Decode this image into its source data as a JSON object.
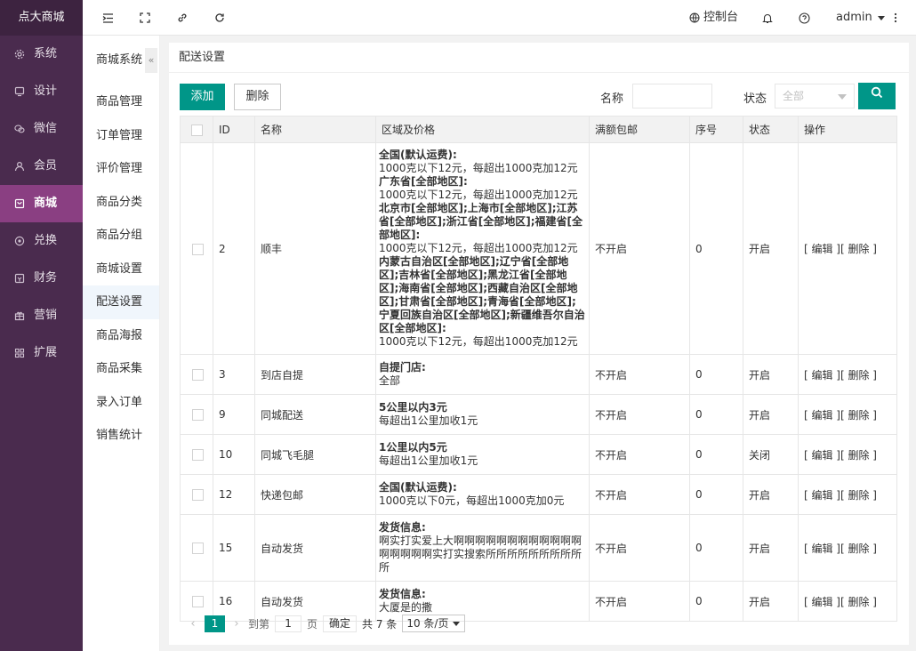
{
  "app": {
    "logo": "点大商城"
  },
  "sidebar": {
    "items": [
      {
        "label": "系统",
        "icon": "gear-icon"
      },
      {
        "label": "设计",
        "icon": "monitor-icon"
      },
      {
        "label": "微信",
        "icon": "wechat-icon"
      },
      {
        "label": "会员",
        "icon": "user-icon"
      },
      {
        "label": "商城",
        "icon": "shop-icon",
        "active": true
      },
      {
        "label": "兑换",
        "icon": "exchange-icon"
      },
      {
        "label": "财务",
        "icon": "finance-icon"
      },
      {
        "label": "营销",
        "icon": "gift-icon"
      },
      {
        "label": "扩展",
        "icon": "grid-icon"
      }
    ]
  },
  "topbar": {
    "console_label": "控制台",
    "user_label": "admin"
  },
  "submenu": {
    "title": "商城系统",
    "collapse": "«",
    "items": [
      "商品管理",
      "订单管理",
      "评价管理",
      "商品分类",
      "商品分组",
      "商城设置",
      "配送设置",
      "商品海报",
      "商品采集",
      "录入订单",
      "销售统计"
    ],
    "active_index": 6
  },
  "main": {
    "title": "配送设置",
    "add_button": "添加",
    "delete_button": "删除",
    "name_label": "名称",
    "name_value": "",
    "status_label": "状态",
    "status_placeholder": "全部"
  },
  "table": {
    "headers": [
      "",
      "ID",
      "名称",
      "区域及价格",
      "满额包邮",
      "序号",
      "状态",
      "操作"
    ],
    "rows": [
      {
        "id": "2",
        "name": "顺丰",
        "region": [
          {
            "zone": "全国(默认运费):",
            "price": "1000克以下12元，每超出1000克加12元"
          },
          {
            "zone": "广东省[全部地区]:",
            "price": "1000克以下12元，每超出1000克加12元"
          },
          {
            "zone": "北京市[全部地区];上海市[全部地区];江苏省[全部地区];浙江省[全部地区];福建省[全部地区]:",
            "price": "1000克以下12元，每超出1000克加12元"
          },
          {
            "zone": "内蒙古自治区[全部地区];辽宁省[全部地区];吉林省[全部地区];黑龙江省[全部地区];海南省[全部地区];西藏自治区[全部地区];甘肃省[全部地区];青海省[全部地区];宁夏回族自治区[全部地区];新疆维吾尔自治区[全部地区]:",
            "price": "1000克以下12元，每超出1000克加12元"
          }
        ],
        "free": "不开启",
        "seq": "0",
        "status": "开启",
        "on": true
      },
      {
        "id": "3",
        "name": "到店自提",
        "region": [
          {
            "zone": "自提门店:",
            "price": "全部"
          }
        ],
        "free": "不开启",
        "seq": "0",
        "status": "开启",
        "on": true
      },
      {
        "id": "9",
        "name": "同城配送",
        "region": [
          {
            "zone": "5公里以内3元",
            "price": "每超出1公里加收1元"
          }
        ],
        "free": "不开启",
        "seq": "0",
        "status": "开启",
        "on": true
      },
      {
        "id": "10",
        "name": "同城飞毛腿",
        "region": [
          {
            "zone": "1公里以内5元",
            "price": "每超出1公里加收1元"
          }
        ],
        "free": "不开启",
        "seq": "0",
        "status": "关闭",
        "on": false
      },
      {
        "id": "12",
        "name": "快递包邮",
        "region": [
          {
            "zone": "全国(默认运费):",
            "price": "1000克以下0元，每超出1000克加0元"
          }
        ],
        "free": "不开启",
        "seq": "0",
        "status": "开启",
        "on": true
      },
      {
        "id": "15",
        "name": "自动发货",
        "region": [
          {
            "zone": "发货信息:",
            "price": "啊实打实爱上大啊啊啊啊啊啊啊啊啊啊啊啊啊啊啊啊啊实打实搜索所所所所所所所所所所"
          }
        ],
        "free": "不开启",
        "seq": "0",
        "status": "开启",
        "on": true
      },
      {
        "id": "16",
        "name": "自动发货",
        "region": [
          {
            "zone": "发货信息:",
            "price": "大厦是的撒"
          }
        ],
        "free": "不开启",
        "seq": "0",
        "status": "开启",
        "on": true
      }
    ],
    "op_edit": "[ 编辑 ]",
    "op_delete": "[ 删除 ]"
  },
  "pager": {
    "prev": "‹",
    "current": "1",
    "next": "›",
    "goto_label": "到第",
    "goto_value": "1",
    "page_unit": "页",
    "confirm": "确定",
    "total": "共 7 条",
    "limit": "10 条/页"
  },
  "colors": {
    "accent": "#009688",
    "sidebar_bg": "#4a2b4e",
    "sidebar_active": "#8a3f82",
    "status_on": "#008000",
    "status_off": "#ee0000"
  }
}
